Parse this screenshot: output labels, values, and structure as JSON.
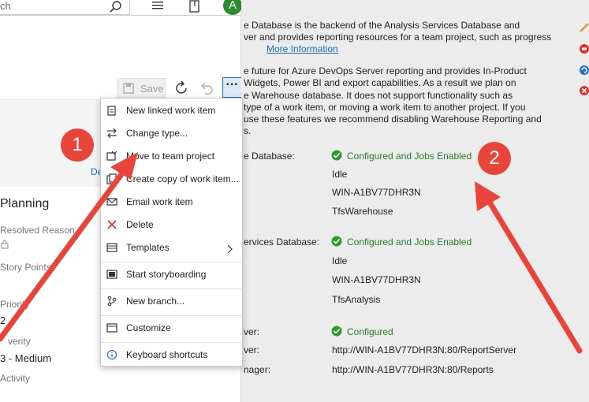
{
  "header": {
    "search_text": "ch",
    "avatar_letter": "A"
  },
  "toolbar": {
    "save_label": "Save"
  },
  "tabs": {
    "details_partial": "De"
  },
  "fields": {
    "section_title": "Planning",
    "resolved_reason_label": "Resolved Reason",
    "story_points_label": "Story Points",
    "priority_label": "Priority",
    "priority_value": "2",
    "severity_label": "verity",
    "severity_value": "3 - Medium",
    "activity_label": "Activity"
  },
  "menu": {
    "items": [
      {
        "label": "New linked work item",
        "icon": "new-linked-icon"
      },
      {
        "label": "Change type...",
        "icon": "change-type-icon"
      },
      {
        "label": "Move to team project",
        "icon": "move-icon"
      },
      {
        "label": "Create copy of work item...",
        "icon": "copy-icon"
      },
      {
        "label": "Email work item",
        "icon": "email-icon"
      },
      {
        "label": "Delete",
        "icon": "delete-icon"
      },
      {
        "label": "Templates",
        "icon": "templates-icon"
      },
      {
        "label": "Start storyboarding",
        "icon": "storyboard-icon"
      },
      {
        "label": "New branch...",
        "icon": "branch-icon"
      },
      {
        "label": "Customize",
        "icon": "customize-icon"
      },
      {
        "label": "Keyboard shortcuts",
        "icon": "keyboard-icon"
      }
    ]
  },
  "right": {
    "para1": [
      "e Database is the backend of the Analysis Services Database and",
      "ver and provides reporting resources for a team project, such as progress"
    ],
    "more_info_link": "More Information",
    "para2": [
      "e future for Azure DevOps Server reporting and provides In-Product",
      "Widgets, Power BI and export capabilities. As a result we plan on",
      "e Warehouse database. It does not support functionality such as",
      "type of a work item, or moving a work item to another project. If you",
      "use these features we recommend disabling Warehouse Reporting and",
      "s."
    ],
    "warehouse_label": "e Database:",
    "warehouse_status": "Configured and Jobs Enabled",
    "warehouse_state": "Idle",
    "warehouse_server": "WIN-A1BV77DHR3N",
    "warehouse_db": "TfsWarehouse",
    "analysis_label": "ervices Database:",
    "analysis_status": "Configured and Jobs Enabled",
    "analysis_state": "Idle",
    "analysis_server": "WIN-A1BV77DHR3N",
    "analysis_db": "TfsAnalysis",
    "reporting_label": "ver:",
    "reporting_status": "Configured",
    "report_server_label": "ver:",
    "report_server_url": "http://WIN-A1BV77DHR3N:80/ReportServer",
    "report_manager_label": "nager:",
    "report_manager_url": "http://WIN-A1BV77DHR3N:80/Reports"
  },
  "annotations": {
    "badge1": "1",
    "badge2": "2",
    "arrow_color": "#e8443a"
  },
  "colors": {
    "accent": "#1d6fc2",
    "success": "#2b7a2b",
    "avatar": "#2e8a2e"
  }
}
